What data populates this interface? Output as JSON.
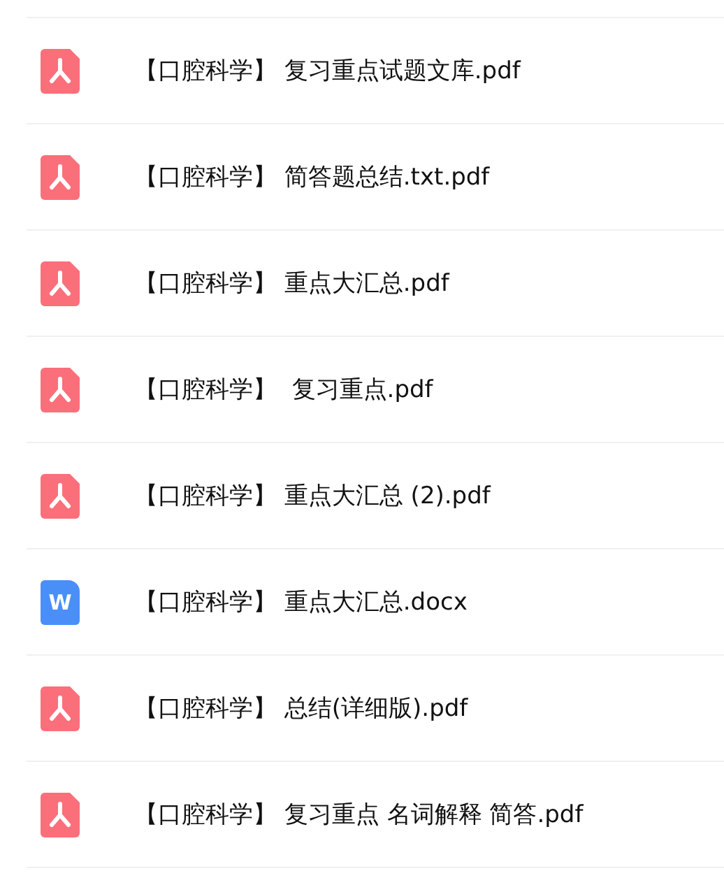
{
  "files": [
    {
      "kind": "pdf",
      "name": "【口腔科学】 复习重点试题文库.pdf"
    },
    {
      "kind": "pdf",
      "name": "【口腔科学】 简答题总结.txt.pdf"
    },
    {
      "kind": "pdf",
      "name": "【口腔科学】 重点大汇总.pdf"
    },
    {
      "kind": "pdf",
      "name": "【口腔科学】  复习重点.pdf"
    },
    {
      "kind": "pdf",
      "name": "【口腔科学】 重点大汇总 (2).pdf"
    },
    {
      "kind": "word",
      "icon_letter": "W",
      "name": "【口腔科学】 重点大汇总.docx"
    },
    {
      "kind": "pdf",
      "name": "【口腔科学】 总结(详细版).pdf"
    },
    {
      "kind": "pdf",
      "name": "【口腔科学】 复习重点 名词解释 简答.pdf"
    }
  ]
}
